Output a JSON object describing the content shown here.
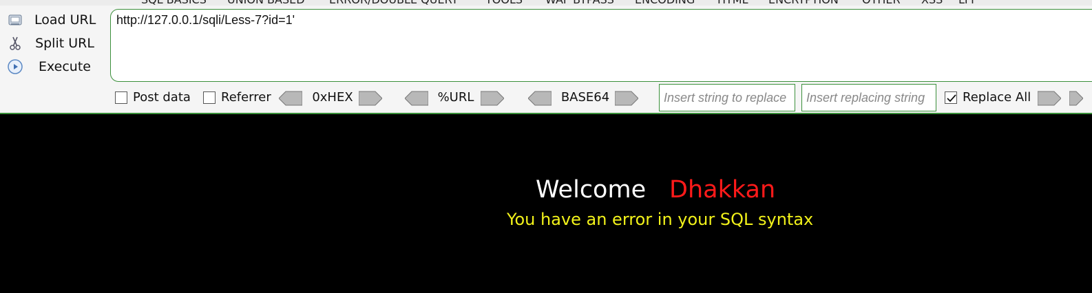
{
  "top_menu": {
    "items": [
      "SQL BASICS",
      "UNION BASED",
      "ERROR/DOUBLE QUERY",
      "TOOLS",
      "WAF BYPASS",
      "ENCODING",
      "HTML",
      "ENCRYPTION",
      "OTHER",
      "XSS",
      "LFI"
    ]
  },
  "actions": {
    "load_url_label": "Load URL",
    "split_url_label": "Split URL",
    "execute_label": "Execute"
  },
  "url_field": {
    "value": "http://127.0.0.1/sqli/Less-7?id=1'"
  },
  "options": {
    "post_data_label": "Post data",
    "referrer_label": "Referrer",
    "hex_label": "0xHEX",
    "url_label": "%URL",
    "base64_label": "BASE64",
    "replace_string_placeholder": "Insert string to replace",
    "replacing_string_placeholder": "Insert replacing string",
    "replace_all_label": "Replace All"
  },
  "page": {
    "welcome_text": "Welcome",
    "name_text": "Dhakkan",
    "error_text": "You have an error in your SQL syntax"
  },
  "colors": {
    "accent_green": "#3a8f3a",
    "name_red": "#ff1a1a",
    "error_yellow": "#f2f21a"
  }
}
